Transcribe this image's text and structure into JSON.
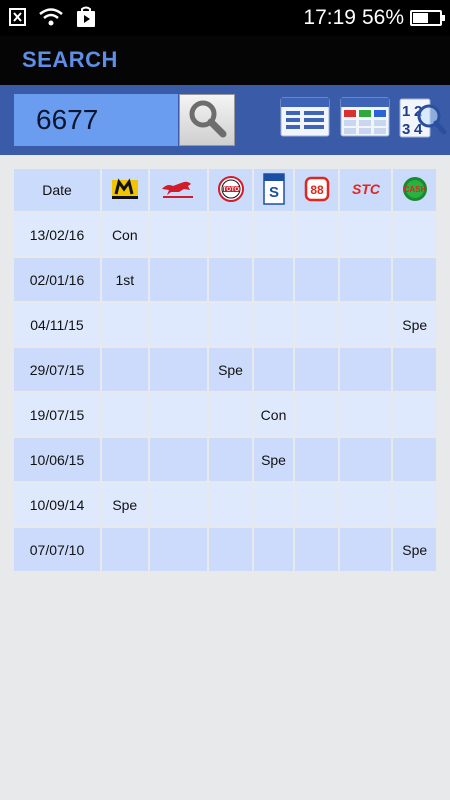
{
  "status": {
    "time": "17:19",
    "battery_text": "56%",
    "battery_level": 0.56
  },
  "title": "SEARCH",
  "search": {
    "value": "6677"
  },
  "table": {
    "header_date": "Date",
    "providers": [
      {
        "id": "magnum",
        "icon": "magnum-logo-icon",
        "label": "Magnum",
        "color": "#f2c500"
      },
      {
        "id": "damacai",
        "icon": "damacai-horse-logo-icon",
        "label": "Da Ma Cai",
        "color": "#d31c2a"
      },
      {
        "id": "toto",
        "icon": "toto-logo-icon",
        "label": "TOTO",
        "color": "#d31c2a"
      },
      {
        "id": "singapore",
        "icon": "singapore-pools-logo-icon",
        "label": "Singapore",
        "color": "#1a4fa3"
      },
      {
        "id": "sabah88",
        "icon": "sabah88-logo-icon",
        "label": "88",
        "color": "#e0261f"
      },
      {
        "id": "stc",
        "icon": "stc-logo-icon",
        "label": "STC",
        "color": "#e0261f"
      },
      {
        "id": "cash",
        "icon": "cash-sweep-logo-icon",
        "label": "CASH",
        "color": "#1a8a2e"
      }
    ],
    "rows": [
      {
        "date": "13/02/16",
        "cells": [
          "Con",
          "",
          "",
          "",
          "",
          "",
          ""
        ]
      },
      {
        "date": "02/01/16",
        "cells": [
          "1st",
          "",
          "",
          "",
          "",
          "",
          ""
        ]
      },
      {
        "date": "04/11/15",
        "cells": [
          "",
          "",
          "",
          "",
          "",
          "",
          "Spe"
        ]
      },
      {
        "date": "29/07/15",
        "cells": [
          "",
          "",
          "Spe",
          "",
          "",
          "",
          ""
        ]
      },
      {
        "date": "19/07/15",
        "cells": [
          "",
          "",
          "",
          "Con",
          "",
          "",
          ""
        ]
      },
      {
        "date": "10/06/15",
        "cells": [
          "",
          "",
          "",
          "Spe",
          "",
          "",
          ""
        ]
      },
      {
        "date": "10/09/14",
        "cells": [
          "Spe",
          "",
          "",
          "",
          "",
          "",
          ""
        ]
      },
      {
        "date": "07/07/10",
        "cells": [
          "",
          "",
          "",
          "",
          "",
          "",
          "Spe"
        ]
      }
    ]
  }
}
